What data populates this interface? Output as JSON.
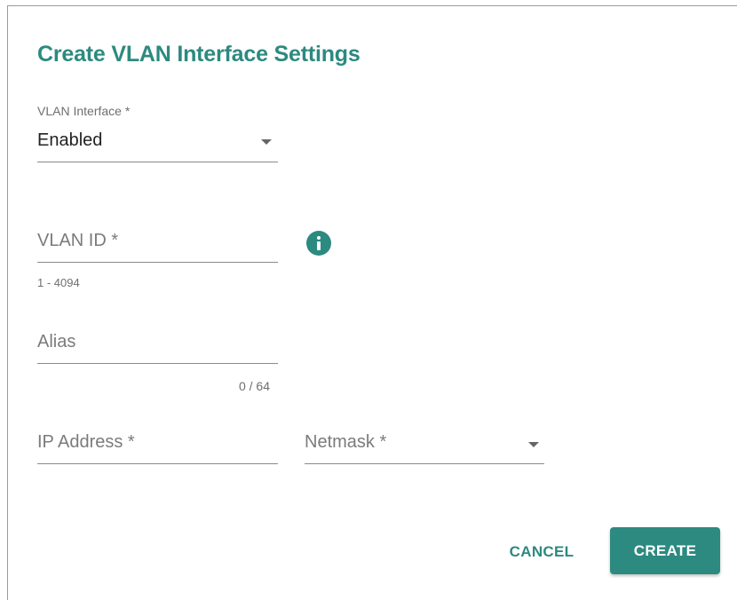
{
  "dialog": {
    "title": "Create VLAN Interface Settings"
  },
  "fields": {
    "vlan_interface": {
      "label": "VLAN Interface *",
      "value": "Enabled",
      "icon": "chevron-down-icon"
    },
    "vlan_id": {
      "placeholder": "VLAN ID *",
      "hint": "1 - 4094",
      "info_icon": "info-icon"
    },
    "alias": {
      "placeholder": "Alias",
      "counter": "0 / 64"
    },
    "ip_address": {
      "placeholder": "IP Address *"
    },
    "netmask": {
      "placeholder": "Netmask *",
      "icon": "chevron-down-icon"
    }
  },
  "actions": {
    "cancel_label": "CANCEL",
    "create_label": "CREATE"
  },
  "colors": {
    "accent": "#2c8a80",
    "text": "#222222",
    "muted": "#6f6f6f"
  }
}
